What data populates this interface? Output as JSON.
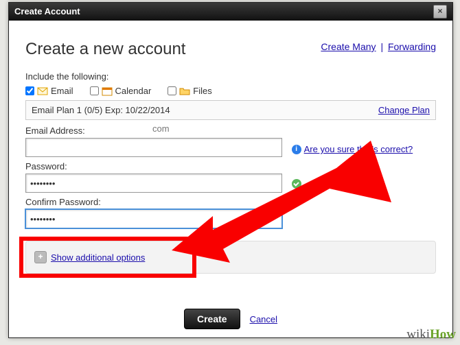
{
  "titlebar": {
    "title": "Create Account"
  },
  "header": {
    "heading": "Create a new account",
    "create_many": "Create Many",
    "forwarding": "Forwarding"
  },
  "include": {
    "label": "Include the following:",
    "email": "Email",
    "calendar": "Calendar",
    "files": "Files"
  },
  "plan": {
    "text": "Email Plan 1 (0/5) Exp: 10/22/2014",
    "change": "Change Plan"
  },
  "email": {
    "label": "Email Address:",
    "domain": "com",
    "hint": "Are you sure that's correct?"
  },
  "password": {
    "label": "Password:",
    "value": "••••••••"
  },
  "confirm": {
    "label": "Confirm Password:",
    "value": "••••••••"
  },
  "options": {
    "show": "Show additional options"
  },
  "buttons": {
    "create": "Create",
    "cancel": "Cancel"
  },
  "watermark": {
    "wiki": "wiki",
    "how": "How"
  }
}
